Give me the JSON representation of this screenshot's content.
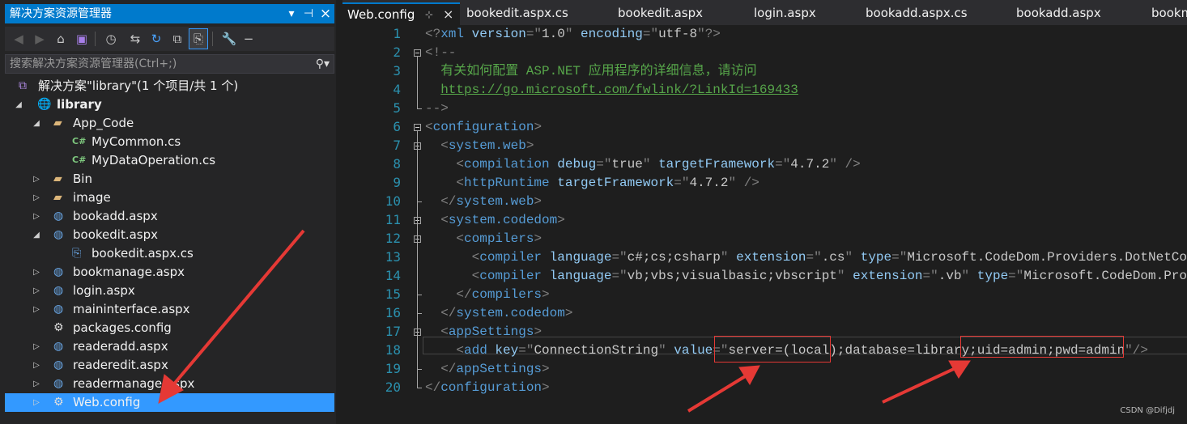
{
  "solution_explorer": {
    "title": "解决方案资源管理器",
    "search_placeholder": "搜索解决方案资源管理器(Ctrl+;)",
    "title_controls": [
      "▾",
      "⊣",
      "×"
    ],
    "tree": [
      {
        "label": "解决方案\"library\"(1 个项目/共 1 个)",
        "icon": "solution-icon",
        "indent": 0,
        "arrow": ""
      },
      {
        "label": "library",
        "icon": "web-project-icon",
        "indent": 0,
        "arrow": "expanded",
        "bold": true
      },
      {
        "label": "App_Code",
        "icon": "folder-open-icon",
        "indent": 1,
        "arrow": "expanded"
      },
      {
        "label": "MyCommon.cs",
        "icon": "csharp-file-icon",
        "indent": 2,
        "arrow": ""
      },
      {
        "label": "MyDataOperation.cs",
        "icon": "csharp-file-icon",
        "indent": 2,
        "arrow": ""
      },
      {
        "label": "Bin",
        "icon": "folder-icon",
        "indent": 1,
        "arrow": "collapsed"
      },
      {
        "label": "image",
        "icon": "folder-icon",
        "indent": 1,
        "arrow": "collapsed"
      },
      {
        "label": "bookadd.aspx",
        "icon": "aspx-file-icon",
        "indent": 1,
        "arrow": "collapsed"
      },
      {
        "label": "bookedit.aspx",
        "icon": "aspx-file-icon",
        "indent": 1,
        "arrow": "expanded"
      },
      {
        "label": "bookedit.aspx.cs",
        "icon": "cs-code-behind-icon",
        "indent": 2,
        "arrow": ""
      },
      {
        "label": "bookmanage.aspx",
        "icon": "aspx-file-icon",
        "indent": 1,
        "arrow": "collapsed"
      },
      {
        "label": "login.aspx",
        "icon": "aspx-file-icon",
        "indent": 1,
        "arrow": "collapsed"
      },
      {
        "label": "maininterface.aspx",
        "icon": "aspx-file-icon",
        "indent": 1,
        "arrow": "collapsed"
      },
      {
        "label": "packages.config",
        "icon": "config-file-icon",
        "indent": 1,
        "arrow": ""
      },
      {
        "label": "readeradd.aspx",
        "icon": "aspx-file-icon",
        "indent": 1,
        "arrow": "collapsed"
      },
      {
        "label": "readeredit.aspx",
        "icon": "aspx-file-icon",
        "indent": 1,
        "arrow": "collapsed"
      },
      {
        "label": "readermanage.aspx",
        "icon": "aspx-file-icon",
        "indent": 1,
        "arrow": "collapsed"
      },
      {
        "label": "Web.config",
        "icon": "config-file-icon",
        "indent": 1,
        "arrow": "collapsed",
        "selected": true
      }
    ]
  },
  "editor": {
    "tabs": [
      {
        "label": "Web.config",
        "active": true,
        "pin": "⊹",
        "close": "×"
      },
      {
        "label": "bookedit.aspx.cs"
      },
      {
        "label": "bookedit.aspx"
      },
      {
        "label": "login.aspx"
      },
      {
        "label": "bookadd.aspx.cs"
      },
      {
        "label": "bookadd.aspx"
      },
      {
        "label": "bookm"
      }
    ],
    "line_numbers": [
      "1",
      "2",
      "3",
      "4",
      "5",
      "6",
      "7",
      "8",
      "9",
      "10",
      "11",
      "12",
      "13",
      "14",
      "15",
      "16",
      "17",
      "18",
      "19",
      "20"
    ],
    "current_line": 18
  },
  "code_lines": [
    [
      [
        "p",
        "<?"
      ],
      [
        "tg",
        "xml"
      ],
      [
        "at",
        " version"
      ],
      [
        "p",
        "=\""
      ],
      [
        "vl",
        "1.0"
      ],
      [
        "p",
        "\""
      ],
      [
        "at",
        " encoding"
      ],
      [
        "p",
        "=\""
      ],
      [
        "vl",
        "utf-8"
      ],
      [
        "p",
        "\"?>"
      ]
    ],
    [
      [
        "p",
        "<!--"
      ]
    ],
    [
      [
        "cm",
        "  有关如何配置 ASP.NET 应用程序的详细信息，请访问"
      ]
    ],
    [
      [
        "cm",
        "  "
      ],
      [
        "lk",
        "https://go.microsoft.com/fwlink/?LinkId=169433"
      ]
    ],
    [
      [
        "p",
        "-->"
      ]
    ],
    [
      [
        "p",
        "<"
      ],
      [
        "tg",
        "configuration"
      ],
      [
        "p",
        ">"
      ]
    ],
    [
      [
        "p",
        "  <"
      ],
      [
        "tg",
        "system.web"
      ],
      [
        "p",
        ">"
      ]
    ],
    [
      [
        "p",
        "    <"
      ],
      [
        "tg",
        "compilation"
      ],
      [
        "at",
        " debug"
      ],
      [
        "p",
        "=\""
      ],
      [
        "vl",
        "true"
      ],
      [
        "p",
        "\""
      ],
      [
        "at",
        " targetFramework"
      ],
      [
        "p",
        "=\""
      ],
      [
        "vl",
        "4.7.2"
      ],
      [
        "p",
        "\" />"
      ]
    ],
    [
      [
        "p",
        "    <"
      ],
      [
        "tg",
        "httpRuntime"
      ],
      [
        "at",
        " targetFramework"
      ],
      [
        "p",
        "=\""
      ],
      [
        "vl",
        "4.7.2"
      ],
      [
        "p",
        "\" />"
      ]
    ],
    [
      [
        "p",
        "  </"
      ],
      [
        "tg",
        "system.web"
      ],
      [
        "p",
        ">"
      ]
    ],
    [
      [
        "p",
        "  <"
      ],
      [
        "tg",
        "system.codedom"
      ],
      [
        "p",
        ">"
      ]
    ],
    [
      [
        "p",
        "    <"
      ],
      [
        "tg",
        "compilers"
      ],
      [
        "p",
        ">"
      ]
    ],
    [
      [
        "p",
        "      <"
      ],
      [
        "tg",
        "compiler"
      ],
      [
        "at",
        " language"
      ],
      [
        "p",
        "=\""
      ],
      [
        "vl",
        "c#;cs;csharp"
      ],
      [
        "p",
        "\""
      ],
      [
        "at",
        " extension"
      ],
      [
        "p",
        "=\""
      ],
      [
        "vl",
        ".cs"
      ],
      [
        "p",
        "\""
      ],
      [
        "at",
        " type"
      ],
      [
        "p",
        "=\""
      ],
      [
        "vl",
        "Microsoft.CodeDom.Providers.DotNetCompil"
      ]
    ],
    [
      [
        "p",
        "      <"
      ],
      [
        "tg",
        "compiler"
      ],
      [
        "at",
        " language"
      ],
      [
        "p",
        "=\""
      ],
      [
        "vl",
        "vb;vbs;visualbasic;vbscript"
      ],
      [
        "p",
        "\""
      ],
      [
        "at",
        " extension"
      ],
      [
        "p",
        "=\""
      ],
      [
        "vl",
        ".vb"
      ],
      [
        "p",
        "\""
      ],
      [
        "at",
        " type"
      ],
      [
        "p",
        "=\""
      ],
      [
        "vl",
        "Microsoft.CodeDom.Provide"
      ]
    ],
    [
      [
        "p",
        "    </"
      ],
      [
        "tg",
        "compilers"
      ],
      [
        "p",
        ">"
      ]
    ],
    [
      [
        "p",
        "  </"
      ],
      [
        "tg",
        "system.codedom"
      ],
      [
        "p",
        ">"
      ]
    ],
    [
      [
        "p",
        "  <"
      ],
      [
        "tg",
        "appSettings"
      ],
      [
        "p",
        ">"
      ]
    ],
    [
      [
        "p",
        "    <"
      ],
      [
        "tg",
        "add"
      ],
      [
        "at",
        " key"
      ],
      [
        "p",
        "=\""
      ],
      [
        "vl",
        "ConnectionString"
      ],
      [
        "p",
        "\""
      ],
      [
        "at",
        " value"
      ],
      [
        "p",
        "=\""
      ],
      [
        "vl",
        "server=(local);database=library;uid=admin;pwd=admin"
      ],
      [
        "p",
        "\"/>"
      ]
    ],
    [
      [
        "p",
        "  </"
      ],
      [
        "tg",
        "appSettings"
      ],
      [
        "p",
        ">"
      ]
    ],
    [
      [
        "p",
        "</"
      ],
      [
        "tg",
        "configuration"
      ],
      [
        "p",
        ">"
      ]
    ]
  ],
  "watermark": "CSDN @Difjdj",
  "colors": {
    "accent": "#007acc",
    "selection": "#3399ff",
    "annotation_red": "#e53935",
    "xml_tag": "#569cd6",
    "xml_attr": "#92caf4",
    "xml_comment": "#57a64a",
    "line_number": "#2b91af"
  }
}
